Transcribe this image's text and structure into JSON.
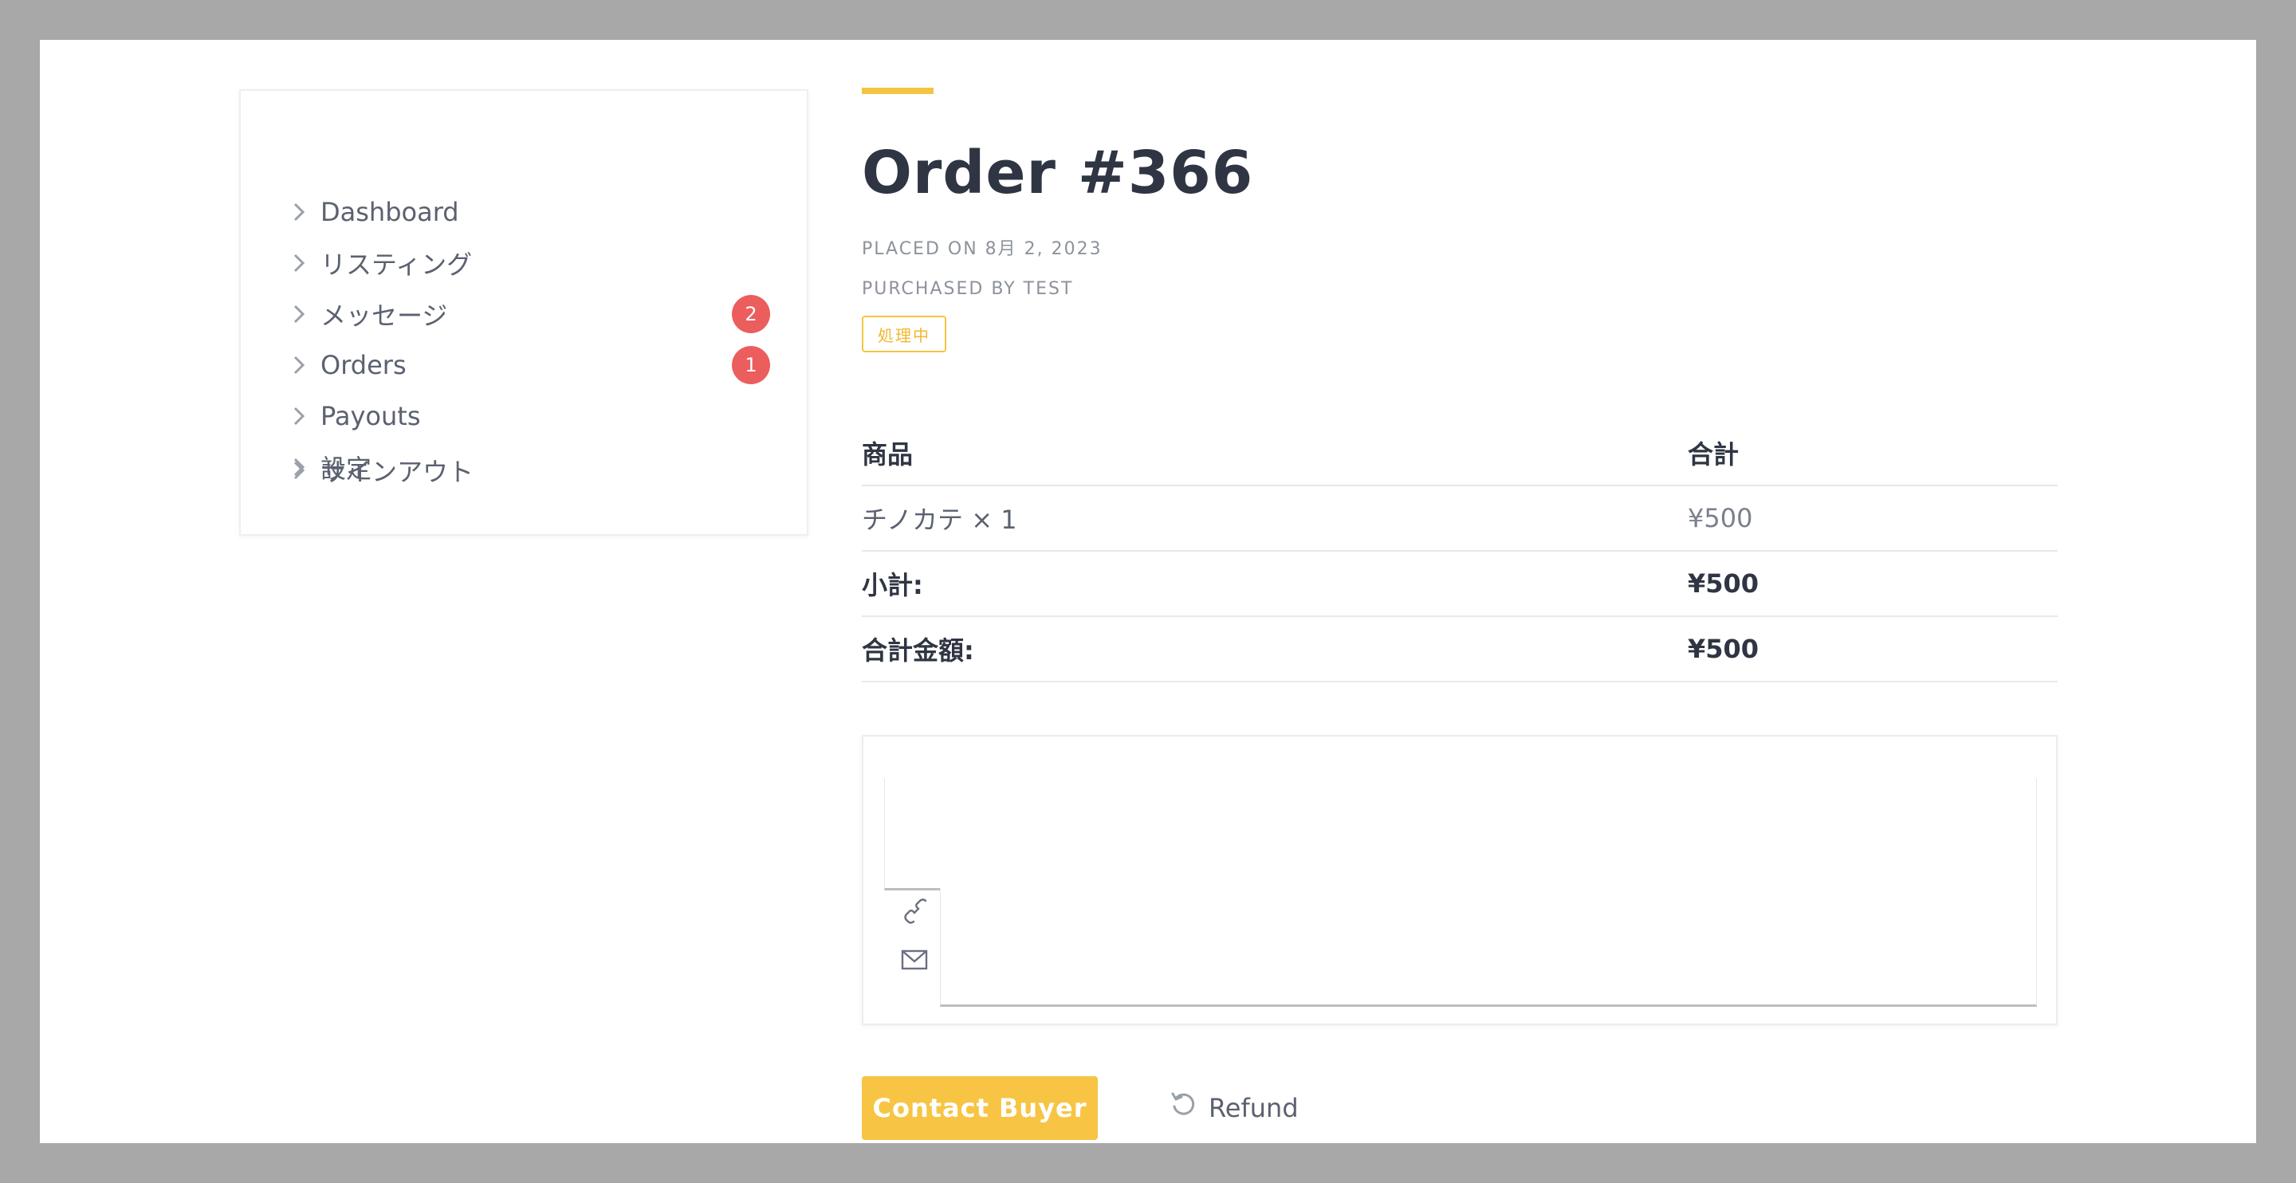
{
  "sidebar": {
    "items": [
      {
        "label": "Dashboard",
        "badge": null
      },
      {
        "label": "リスティング",
        "badge": null
      },
      {
        "label": "メッセージ",
        "badge": "2"
      },
      {
        "label": "Orders",
        "badge": "1"
      },
      {
        "label": "Payouts",
        "badge": null
      },
      {
        "label": "設定",
        "badge": null
      },
      {
        "label": "サインアウト",
        "badge": null
      }
    ]
  },
  "order": {
    "title": "Order #366",
    "placed_on": "PLACED ON 8月 2, 2023",
    "purchased_by": "PURCHASED BY TEST",
    "status": "処理中"
  },
  "table": {
    "headers": {
      "product": "商品",
      "total": "合計"
    },
    "item": {
      "name": "チノカテ × 1",
      "price": "¥500"
    },
    "subtotal": {
      "label": "小計:",
      "value": "¥500"
    },
    "grand_total": {
      "label": "合計金額:",
      "value": "¥500"
    }
  },
  "contact": {
    "icons": [
      "phone-icon",
      "mail-icon"
    ]
  },
  "actions": {
    "contact_buyer": "Contact Buyer",
    "refund": "Refund"
  },
  "colors": {
    "accent": "#f7c543",
    "badge": "#ec5d5d",
    "frame_bg": "#a8a8a8"
  }
}
